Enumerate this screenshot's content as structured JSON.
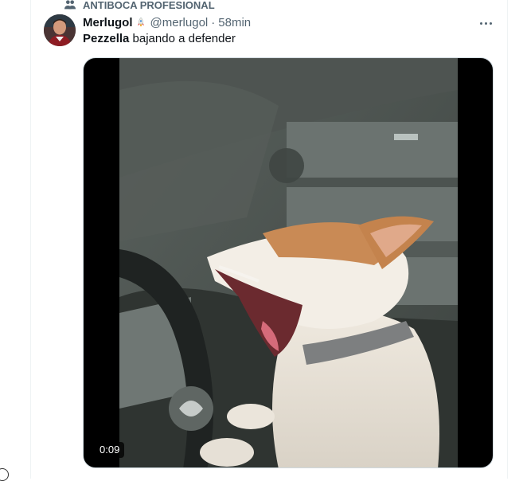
{
  "context": {
    "label": "ANTIBOCA PROFESIONAL",
    "icon": "people-icon"
  },
  "tweet": {
    "author_name": "Merlugol",
    "badge_icon": "rocket-emoji",
    "handle": "@merlugol",
    "separator": "·",
    "time": "58min",
    "text_bold": "Pezzella",
    "text_rest": " bajando a defender"
  },
  "media": {
    "type": "video",
    "duration": "0:09"
  },
  "colors": {
    "secondary_text": "#536471",
    "primary_text": "#0f1419",
    "border": "#cfd9de"
  }
}
